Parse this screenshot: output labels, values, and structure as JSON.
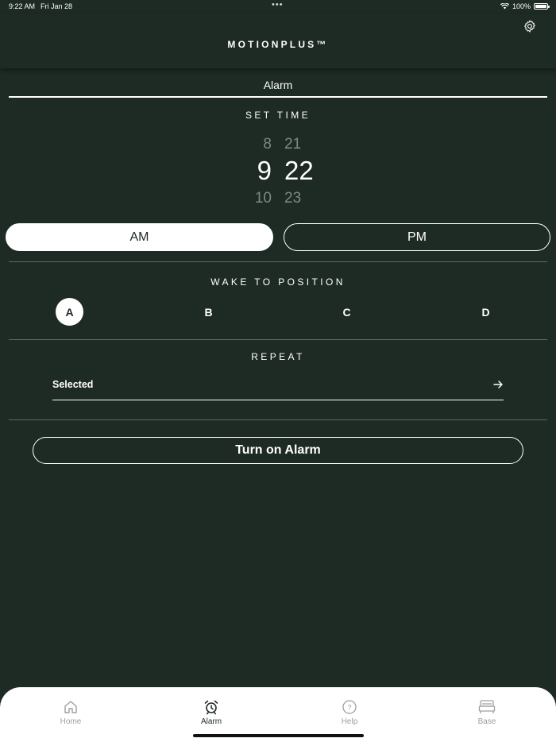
{
  "status_bar": {
    "time": "9:22 AM",
    "date": "Fri Jan 28",
    "dots": "•••",
    "battery": "100%"
  },
  "header": {
    "brand": "MOTIONPLUS™",
    "settings_icon": "gear-icon"
  },
  "tab_title": "Alarm",
  "set_time": {
    "label": "SET TIME",
    "hour_prev": "8",
    "hour": "9",
    "hour_next": "10",
    "minute_prev": "21",
    "minute": "22",
    "minute_next": "23"
  },
  "meridiem": {
    "am": "AM",
    "pm": "PM",
    "selected": "AM"
  },
  "wake_position": {
    "label": "WAKE TO POSITION",
    "options": [
      "A",
      "B",
      "C",
      "D"
    ],
    "selected": "A"
  },
  "repeat": {
    "label": "REPEAT",
    "value": "Selected",
    "arrow_icon": "arrow-right-icon"
  },
  "turn_on_button": "Turn on Alarm",
  "tabbar": {
    "items": [
      {
        "label": "Home",
        "icon": "home-icon"
      },
      {
        "label": "Alarm",
        "icon": "alarm-clock-icon"
      },
      {
        "label": "Help",
        "icon": "help-icon"
      },
      {
        "label": "Base",
        "icon": "bed-icon"
      }
    ],
    "active": "Alarm"
  },
  "colors": {
    "background": "#1e2a24",
    "foreground": "#ffffff",
    "muted": "#7d8a84",
    "tab_inactive": "#9aa09d"
  }
}
